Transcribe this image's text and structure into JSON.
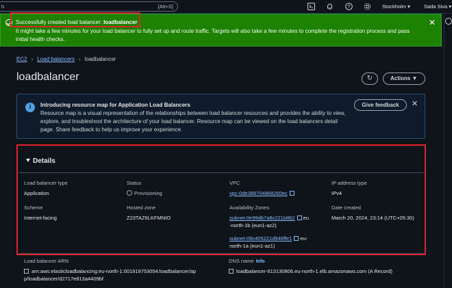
{
  "topnav": {
    "search_value": "h",
    "search_shortcut": "[Alt+S]",
    "region": "Stockholm ▾",
    "user": "Sada Siva ▾"
  },
  "flash": {
    "title_prefix": "Successfully created load balancer: ",
    "title_name": "loadbalancer",
    "body": "It might take a few minutes for your load balancer to fully set up and route traffic. Targets will also take a few minutes to complete the registration process and pass initial health checks.",
    "close": "✕"
  },
  "breadcrumb": {
    "ec2": "EC2",
    "load_balancers": "Load balancers",
    "current": "loadbalancer"
  },
  "page": {
    "title": "loadbalancer",
    "refresh": "↻",
    "actions": "Actions ▼"
  },
  "info": {
    "icon": "i",
    "title": "Introducing resource map for Application Load Balancers",
    "text": "Resource map is a visual representation of the relationships between load balancer resources and provides the ability to view, explore, and troubleshoot the architecture of your load balancer. Resource map can be viewed on the load balancers detail page. Share feedback to help us improve your experience.",
    "feedback": "Give feedback",
    "close": "✕"
  },
  "details": {
    "header": "Details",
    "lb_type_label": "Load balancer type",
    "lb_type": "Application",
    "status_label": "Status",
    "status": "Provisioning",
    "vpc_label": "VPC",
    "vpc": "vpc-0de388704868260ec",
    "ip_label": "IP address type",
    "ip": "IPv4",
    "scheme_label": "Scheme",
    "scheme": "Internet-facing",
    "zone_label": "Hosted zone",
    "zone": "Z23TAZ6LKFMNIO",
    "az_label": "Availability Zones",
    "subnet1": "subnet-0e99db7a8c221b862",
    "subnet1_suffix_a": "eu",
    "subnet1_suffix_b": "-north-1b (eun1-az2)",
    "subnet2": "subnet-09c405221d946ffe1",
    "subnet2_suffix_a": "eu-",
    "subnet2_suffix_b": "north-1a (eun1-az1)",
    "created_label": "Date created",
    "created": "March 20, 2024, 23:14 (UTC+05:30)"
  },
  "bottom": {
    "arn_label": "Load balancer ARN",
    "arn_line1": "arn:aws:elasticloadbalancing:eu-north-1:001919753054:loadbalancer/ap",
    "arn_line2": "p/loadbalancer/d2717e813a4409bf",
    "dns_label": "DNS name",
    "dns_info": "Info",
    "dns": "loadbalancer-613130806.eu-north-1.elb.amazonaws.com (A Record)"
  }
}
